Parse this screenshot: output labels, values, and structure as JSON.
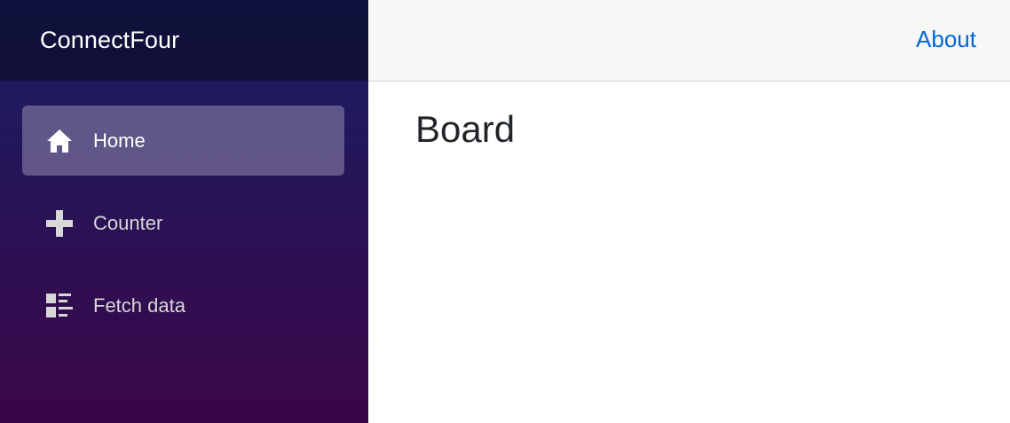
{
  "brand": {
    "title": "ConnectFour"
  },
  "nav": {
    "items": [
      {
        "label": "Home",
        "icon": "home-icon",
        "active": true
      },
      {
        "label": "Counter",
        "icon": "plus-icon",
        "active": false
      },
      {
        "label": "Fetch data",
        "icon": "list-rich-icon",
        "active": false
      }
    ]
  },
  "top_row": {
    "about_label": "About"
  },
  "main": {
    "title": "Board"
  },
  "colors": {
    "sidebar_top": "#1a1f66",
    "sidebar_bottom": "#3a0647",
    "link": "#0366d6",
    "top_row_bg": "#f7f7f7"
  }
}
